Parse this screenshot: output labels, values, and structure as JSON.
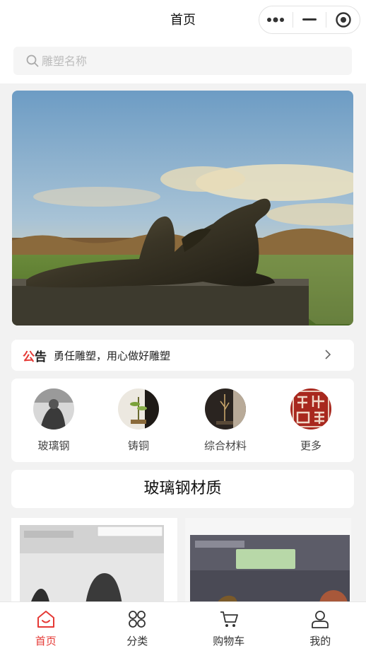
{
  "nav": {
    "title": "首页"
  },
  "search": {
    "placeholder": "雕塑名称"
  },
  "notice": {
    "tag_red": "公",
    "tag_dark": "告",
    "text": "勇任雕塑，用心做好雕塑"
  },
  "categories": [
    {
      "label": "玻璃钢"
    },
    {
      "label": "铸铜"
    },
    {
      "label": "综合材料"
    },
    {
      "label": "更多"
    }
  ],
  "section": {
    "title": "玻璃钢材质"
  },
  "tabbar": {
    "items": [
      {
        "label": "首页",
        "icon": "home-icon",
        "active": true
      },
      {
        "label": "分类",
        "icon": "category-icon",
        "active": false
      },
      {
        "label": "购物车",
        "icon": "cart-icon",
        "active": false
      },
      {
        "label": "我的",
        "icon": "user-icon",
        "active": false
      }
    ]
  },
  "colors": {
    "accent": "#e53935",
    "page_bg": "#f2f2f2"
  }
}
